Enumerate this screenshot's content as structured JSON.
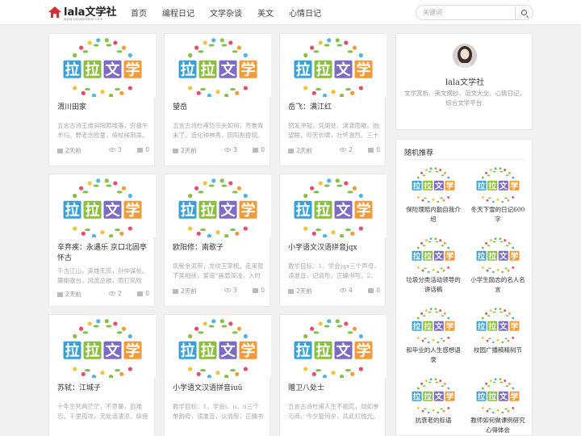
{
  "header": {
    "logo_text": "lala文学社",
    "logo_sub": "www.lalawenxue.com",
    "nav": [
      "首页",
      "编程日记",
      "文学杂谈",
      "美文",
      "心情日记"
    ],
    "search_placeholder": "关键词"
  },
  "thumb_text": [
    "拉",
    "拉",
    "文",
    "学"
  ],
  "colors": {
    "la1": "#3aa1d8",
    "la2": "#8bbf3f",
    "wen": "#7d6cc4",
    "xue": "#f39a3a"
  },
  "cards": [
    {
      "title": "渭川田家",
      "excerpt": "五言古诗王维斜阳照墟落，穷巷牛羊归。野老念牧童，倚杖候荆扉。雉",
      "date": "2天前",
      "views": "3",
      "comments": "0"
    },
    {
      "title": "望岳",
      "excerpt": "五言古诗杜甫岱宗夫如何，齐鲁青未了。造化钟神秀，阴阳割昏晓。荡胸",
      "date": "2天前",
      "views": "3",
      "comments": "0"
    },
    {
      "title": "岳飞：满江红",
      "excerpt": "怒发冲冠，凭阑处、潇潇雨歇。抬望眼，仰天长啸，壮怀激烈。三十功名",
      "date": "2天前",
      "views": "2",
      "comments": "0"
    },
    {
      "title": "辛弃疾：永遇乐 京口北固亭怀古",
      "excerpt": "千古江山，英雄无觅，孙仲谋处。舞榭歌台，风流总被，雨打风吹去。斜",
      "date": "2天前",
      "views": "2",
      "comments": "0"
    },
    {
      "title": "欧阳修：南歌子",
      "excerpt": "凤髻金泥带，龙纹玉掌梳。走来窗下笑相扶，爱道“画眉深浅，入时",
      "date": "2天前",
      "views": "3",
      "comments": "0"
    },
    {
      "title": "小学语文汉语拼音jqx",
      "excerpt": "教学目标：1、学会jqx三个声母，读准音，记清形，正确书写。2、初步",
      "date": "2天前",
      "views": "4",
      "comments": "0"
    },
    {
      "title": "苏轼：江城子",
      "excerpt": "十年生死两茫茫，不思量，自难忘。千里孤坟，无处话凄凉。纵使相逢应",
      "date": "",
      "views": "",
      "comments": ""
    },
    {
      "title": "小学语文汉语拼音iuü",
      "excerpt": "教学目标：1、学会i、u、ü三个单韵母，读准音，认清形，正确书",
      "date": "",
      "views": "",
      "comments": ""
    },
    {
      "title": "赠卫八处士",
      "excerpt": "五言古诗杜甫人生不相见，动如参与商。今夕复何夕，共此灯烛光。少壮",
      "date": "",
      "views": "",
      "comments": ""
    }
  ],
  "profile": {
    "name": "lala文学社",
    "desc": "文学赏析、美文摘抄、范文大全、心情日记，综合文学平台."
  },
  "random": {
    "title": "随机推荐",
    "items": [
      "保险理赔内勤自我介绍",
      "冬天下雪的日记600字",
      "垃圾分类活动领导的讲话稿",
      "小学生励志的名人名言",
      "和毕业的人生感想语录",
      "校园广播稿精树节",
      "抗衰老的标语",
      "教师如何做课例研究心得体会"
    ]
  }
}
